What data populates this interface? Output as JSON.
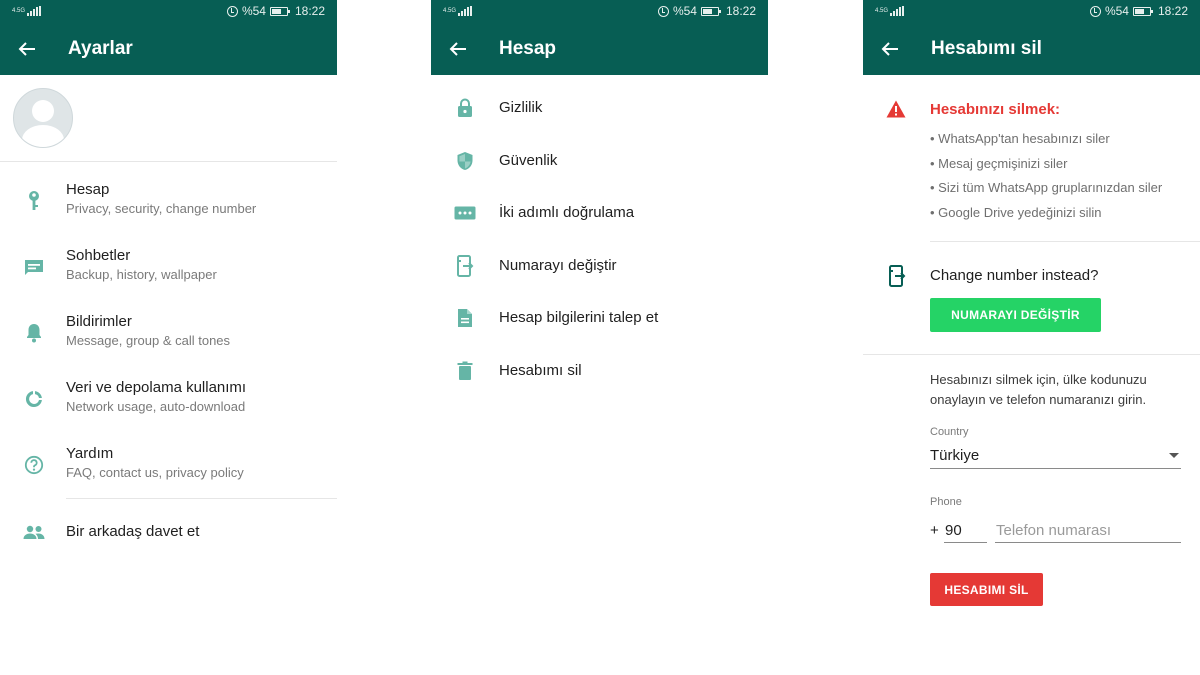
{
  "status_bar": {
    "network": "4.5G",
    "battery": "%54",
    "battery_level": 0.54,
    "time": "18:22"
  },
  "colors": {
    "header": "#075e54",
    "icon_teal": "#65b5a6",
    "accent_green": "#25d366",
    "danger_red": "#e53935"
  },
  "settings": {
    "title": "Ayarlar",
    "items": [
      {
        "icon": "key-icon",
        "title": "Hesap",
        "subtitle": "Privacy, security, change number"
      },
      {
        "icon": "chat-icon",
        "title": "Sohbetler",
        "subtitle": "Backup, history, wallpaper"
      },
      {
        "icon": "bell-icon",
        "title": "Bildirimler",
        "subtitle": "Message, group & call tones"
      },
      {
        "icon": "data-usage-icon",
        "title": "Veri ve depolama kullanımı",
        "subtitle": "Network usage, auto-download"
      },
      {
        "icon": "help-icon",
        "title": "Yardım",
        "subtitle": "FAQ, contact us, privacy policy"
      }
    ],
    "invite": {
      "icon": "people-icon",
      "title": "Bir arkadaş davet et"
    }
  },
  "account": {
    "title": "Hesap",
    "items": [
      {
        "icon": "lock-icon",
        "title": "Gizlilik"
      },
      {
        "icon": "shield-icon",
        "title": "Güvenlik"
      },
      {
        "icon": "dots-icon",
        "title": "İki adımlı doğrulama"
      },
      {
        "icon": "change-number-icon",
        "title": "Numarayı değiştir"
      },
      {
        "icon": "document-icon",
        "title": "Hesap bilgilerini talep et"
      },
      {
        "icon": "trash-icon",
        "title": "Hesabımı sil"
      }
    ]
  },
  "delete_account": {
    "title": "Hesabımı sil",
    "warning_title": "Hesabınızı silmek:",
    "bullets": [
      "WhatsApp'tan hesabınızı siler",
      "Mesaj geçmişinizi siler",
      "Sizi tüm WhatsApp gruplarınızdan siler",
      "Google  Drive yedeğinizi silin"
    ],
    "change_number_prompt": "Change number instead?",
    "change_number_button": "NUMARAYI DEĞİŞTİR",
    "instructions": "Hesabınızı silmek için, ülke kodunuzu onaylayın ve telefon numaranızı girin.",
    "country_label": "Country",
    "country_value": "Türkiye",
    "phone_label": "Phone",
    "phone_plus": "+",
    "country_code": "90",
    "phone_placeholder": "Telefon numarası",
    "phone_value": "",
    "delete_button": "HESABIMI SİL"
  }
}
